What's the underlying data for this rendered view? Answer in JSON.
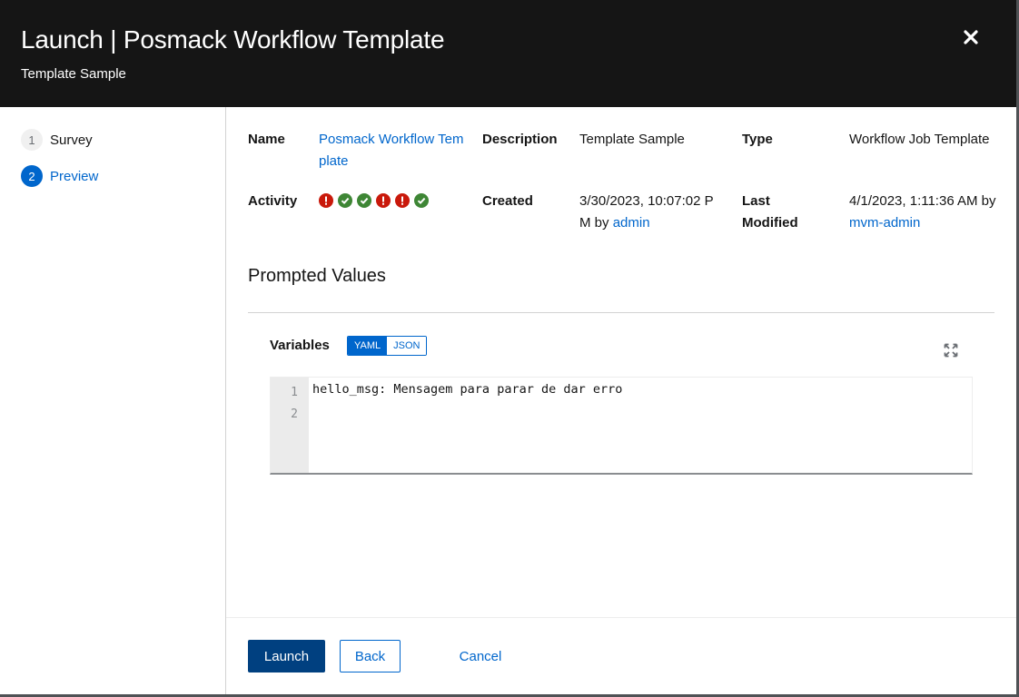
{
  "header": {
    "title": "Launch | Posmack Workflow Template",
    "subtitle": "Template Sample",
    "close_icon": "close-icon"
  },
  "wizard": {
    "steps": [
      {
        "number": "1",
        "label": "Survey",
        "active": false
      },
      {
        "number": "2",
        "label": "Preview",
        "active": true
      }
    ]
  },
  "details": {
    "name_label": "Name",
    "name_value": "Posmack Workflow Template",
    "description_label": "Description",
    "description_value": "Template Sample",
    "type_label": "Type",
    "type_value": "Workflow Job Template",
    "activity_label": "Activity",
    "activity": [
      "failed",
      "success",
      "success",
      "failed",
      "failed",
      "success"
    ],
    "created_label": "Created",
    "created_date": "3/30/2023, 10:07:02 PM",
    "created_by_prefix": "by",
    "created_by": "admin",
    "modified_label": "Last Modified",
    "modified_date": "4/1/2023, 1:11:36 AM",
    "modified_by_prefix": "by",
    "modified_by": "mvm-admin"
  },
  "prompted": {
    "title": "Prompted Values",
    "variables_label": "Variables",
    "toggle": [
      "YAML",
      "JSON"
    ],
    "selected_format": "YAML",
    "line_numbers": [
      "1",
      "2"
    ],
    "code_lines": [
      "hello_msg: Mensagem para parar de dar erro",
      ""
    ]
  },
  "footer": {
    "launch_label": "Launch",
    "back_label": "Back",
    "cancel_label": "Cancel"
  },
  "colors": {
    "header_bg": "#151515",
    "accent": "#0066cc",
    "primary_button": "#004080",
    "failed": "#c9190b",
    "success": "#3e8635"
  }
}
